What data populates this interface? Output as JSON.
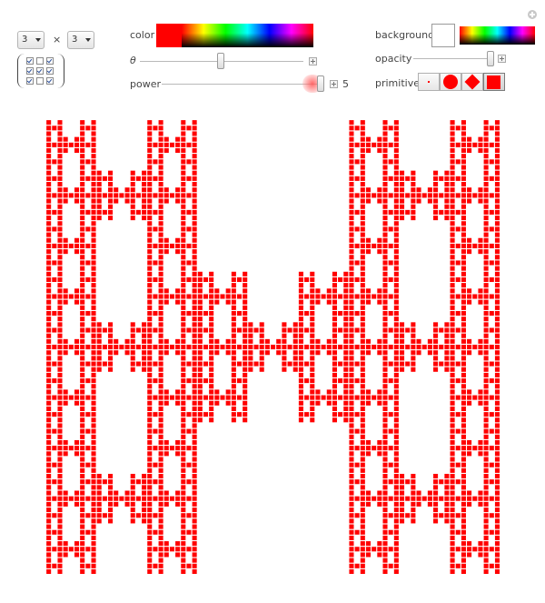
{
  "matrix": {
    "rows_select": "3",
    "times_sign": "×",
    "cols_select": "3",
    "cells": [
      [
        true,
        false,
        true
      ],
      [
        true,
        true,
        true
      ],
      [
        true,
        false,
        true
      ]
    ]
  },
  "controls": {
    "color_label": "color",
    "theta_label": "θ",
    "power_label": "power",
    "power_value": "5",
    "background_label": "background",
    "opacity_label": "opacity",
    "primitive_label": "primitive",
    "primitives": [
      "point",
      "circle",
      "diamond",
      "square"
    ],
    "selected_primitive": "square",
    "theta_fraction": 0.48,
    "power_fraction": 1.0,
    "opacity_fraction": 1.0
  },
  "colors": {
    "fractal_color": "#ff0000",
    "background_color": "#ffffff"
  },
  "icons": {
    "reset": "plus-circle-icon"
  }
}
